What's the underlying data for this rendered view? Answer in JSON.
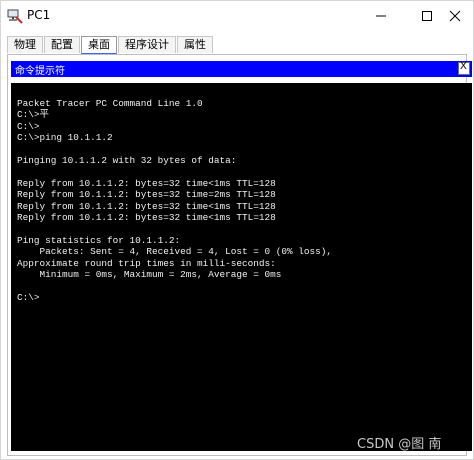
{
  "window": {
    "title": "PC1"
  },
  "tabs": [
    {
      "label": "物理"
    },
    {
      "label": "配置"
    },
    {
      "label": "桌面"
    },
    {
      "label": "程序设计"
    },
    {
      "label": "属性"
    }
  ],
  "active_tab": "桌面",
  "command_prompt": {
    "title": "命令提示符",
    "close_label": "X",
    "lines": [
      "Packet Tracer PC Command Line 1.0",
      "C:\\>平",
      "C:\\>",
      "C:\\>ping 10.1.1.2",
      "",
      "Pinging 10.1.1.2 with 32 bytes of data:",
      "",
      "Reply from 10.1.1.2: bytes=32 time<1ms TTL=128",
      "Reply from 10.1.1.2: bytes=32 time=2ms TTL=128",
      "Reply from 10.1.1.2: bytes=32 time<1ms TTL=128",
      "Reply from 10.1.1.2: bytes=32 time<1ms TTL=128",
      "",
      "Ping statistics for 10.1.1.2:",
      "    Packets: Sent = 4, Received = 4, Lost = 0 (0% loss),",
      "Approximate round trip times in milli-seconds:",
      "    Minimum = 0ms, Maximum = 2ms, Average = 0ms",
      "",
      "C:\\>"
    ]
  },
  "watermark": "CSDN @图  南",
  "colors": {
    "cmd_header": "#0000ff",
    "terminal_bg": "#000000",
    "terminal_fg": "#f2f2f2",
    "active_tab_underline": "#3c64ff"
  },
  "icons": {
    "app": "packet-tracer-pc-icon",
    "minimize": "minimize-icon",
    "maximize": "maximize-icon",
    "close": "close-icon"
  }
}
